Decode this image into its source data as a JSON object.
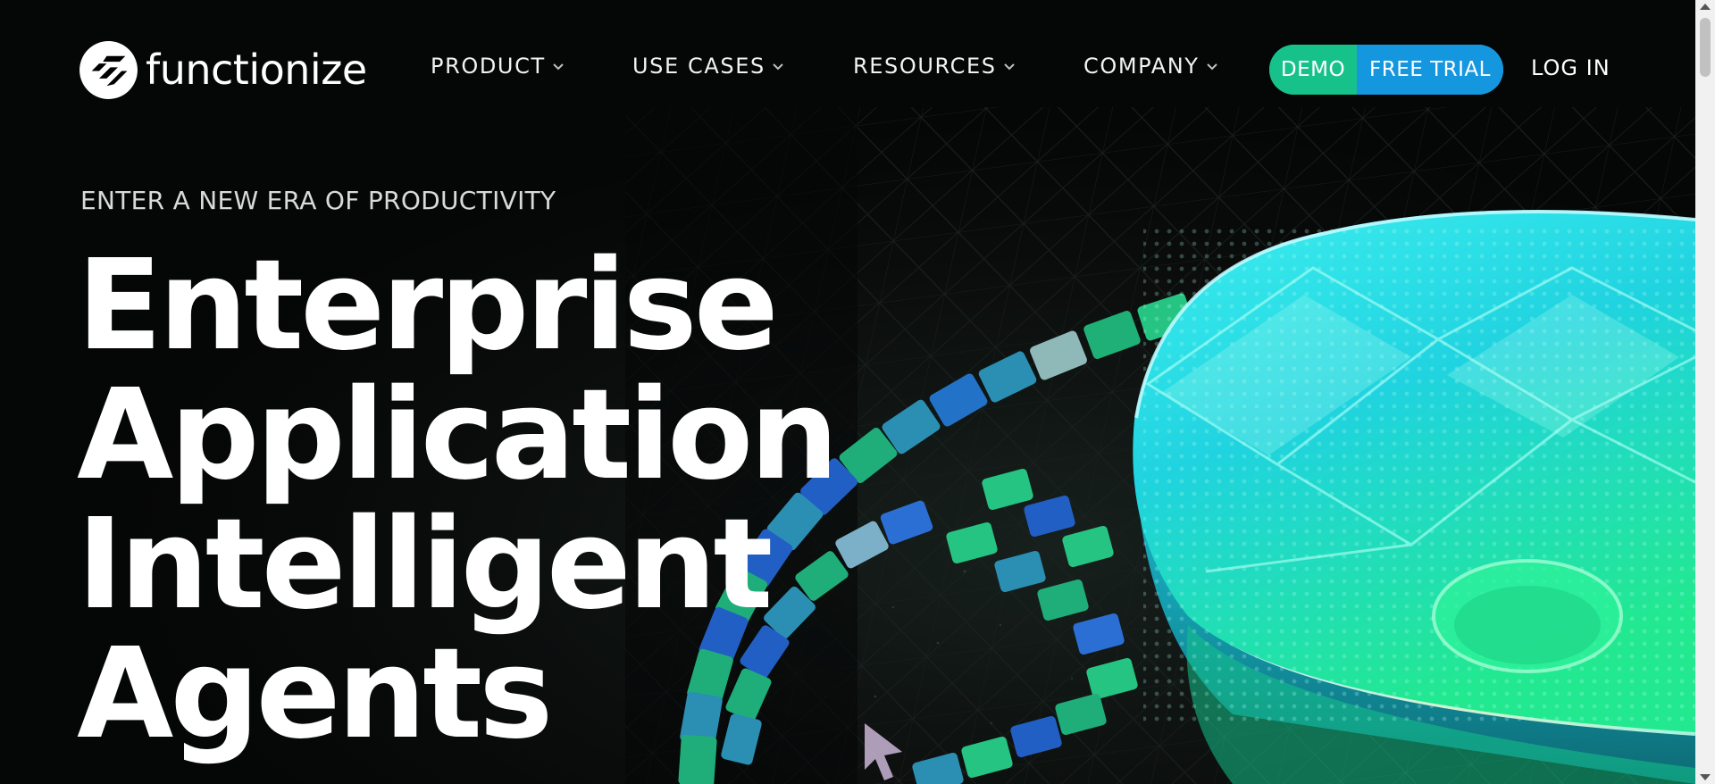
{
  "brand": {
    "name": "functionize",
    "logo_icon": "functionize-logo-icon"
  },
  "nav": {
    "items": [
      {
        "label": "PRODUCT",
        "icon": "chevron-down-icon"
      },
      {
        "label": "USE CASES",
        "icon": "chevron-down-icon"
      },
      {
        "label": "RESOURCES",
        "icon": "chevron-down-icon"
      },
      {
        "label": "COMPANY",
        "icon": "chevron-down-icon"
      }
    ],
    "demo_label": "DEMO",
    "free_trial_label": "FREE TRIAL",
    "login_label": "LOG IN"
  },
  "hero": {
    "eyebrow": "ENTER A NEW ERA OF PRODUCTIVITY",
    "headline_lines": [
      "Enterprise",
      "Application",
      "Intelligent",
      "Agents"
    ],
    "art": "isometric-glass-disc-with-tile-rings"
  },
  "colors": {
    "background": "#050606",
    "demo_button": "#17c28a",
    "free_trial_button": "#1597e0",
    "accent_green": "#22e39a",
    "accent_cyan": "#1fd3e6"
  }
}
